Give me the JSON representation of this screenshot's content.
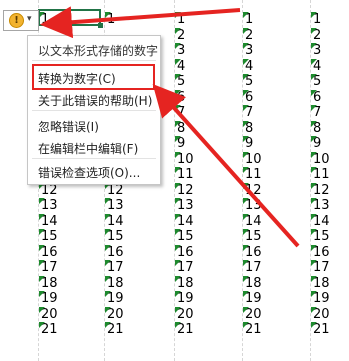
{
  "error_button": {
    "icon": "warning-icon",
    "glyph": "!",
    "dropdown_glyph": "▾"
  },
  "menu": {
    "items": [
      {
        "label": "以文本形式存储的数字"
      },
      {
        "label": "转换为数字(C)",
        "highlighted": true
      },
      {
        "label": "关于此错误的帮助(H)"
      },
      {
        "label": "忽略错误(I)"
      },
      {
        "label": "在编辑栏中编辑(F)"
      },
      {
        "label": "错误检查选项(O)..."
      }
    ]
  },
  "sheet": {
    "rows": [
      1,
      2,
      3,
      4,
      5,
      6,
      7,
      8,
      9,
      10,
      11,
      12,
      13,
      14,
      15,
      16,
      17,
      18,
      19,
      20,
      21
    ]
  },
  "annotation": {
    "highlight_color": "#e52421",
    "triangle_color": "#1e8a2e"
  }
}
